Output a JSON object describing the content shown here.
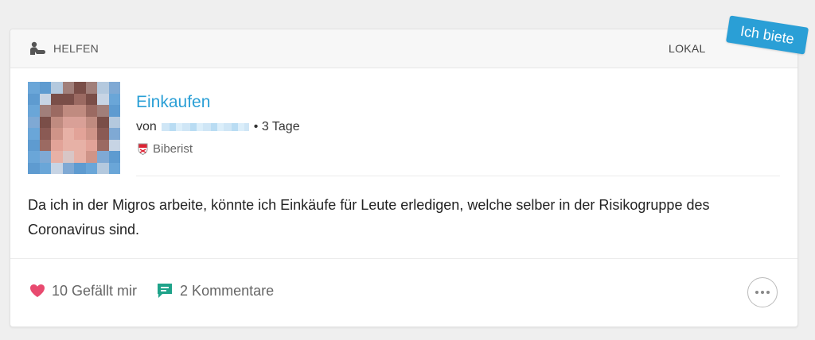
{
  "header": {
    "category_icon": "helping-hand-icon",
    "category_label": "HELFEN",
    "scope_label": "LOKAL",
    "ribbon_label": "Ich biete"
  },
  "post": {
    "title": "Einkaufen",
    "by_prefix": "von",
    "age": "• 3 Tage",
    "location": "Biberist",
    "body": "Da ich in der Migros arbeite, könnte ich Einkäufe für Leute erledigen, welche selber in der Risikogruppe des Coronavirus sind."
  },
  "footer": {
    "likes_label": "10 Gefällt mir",
    "comments_label": "2 Kommentare",
    "like_icon": "heart-icon",
    "comment_icon": "comment-icon",
    "more_icon": "more-options-icon"
  },
  "colors": {
    "accent": "#2a9fd6",
    "heart": "#e84a6f",
    "comment": "#1fa38a"
  }
}
